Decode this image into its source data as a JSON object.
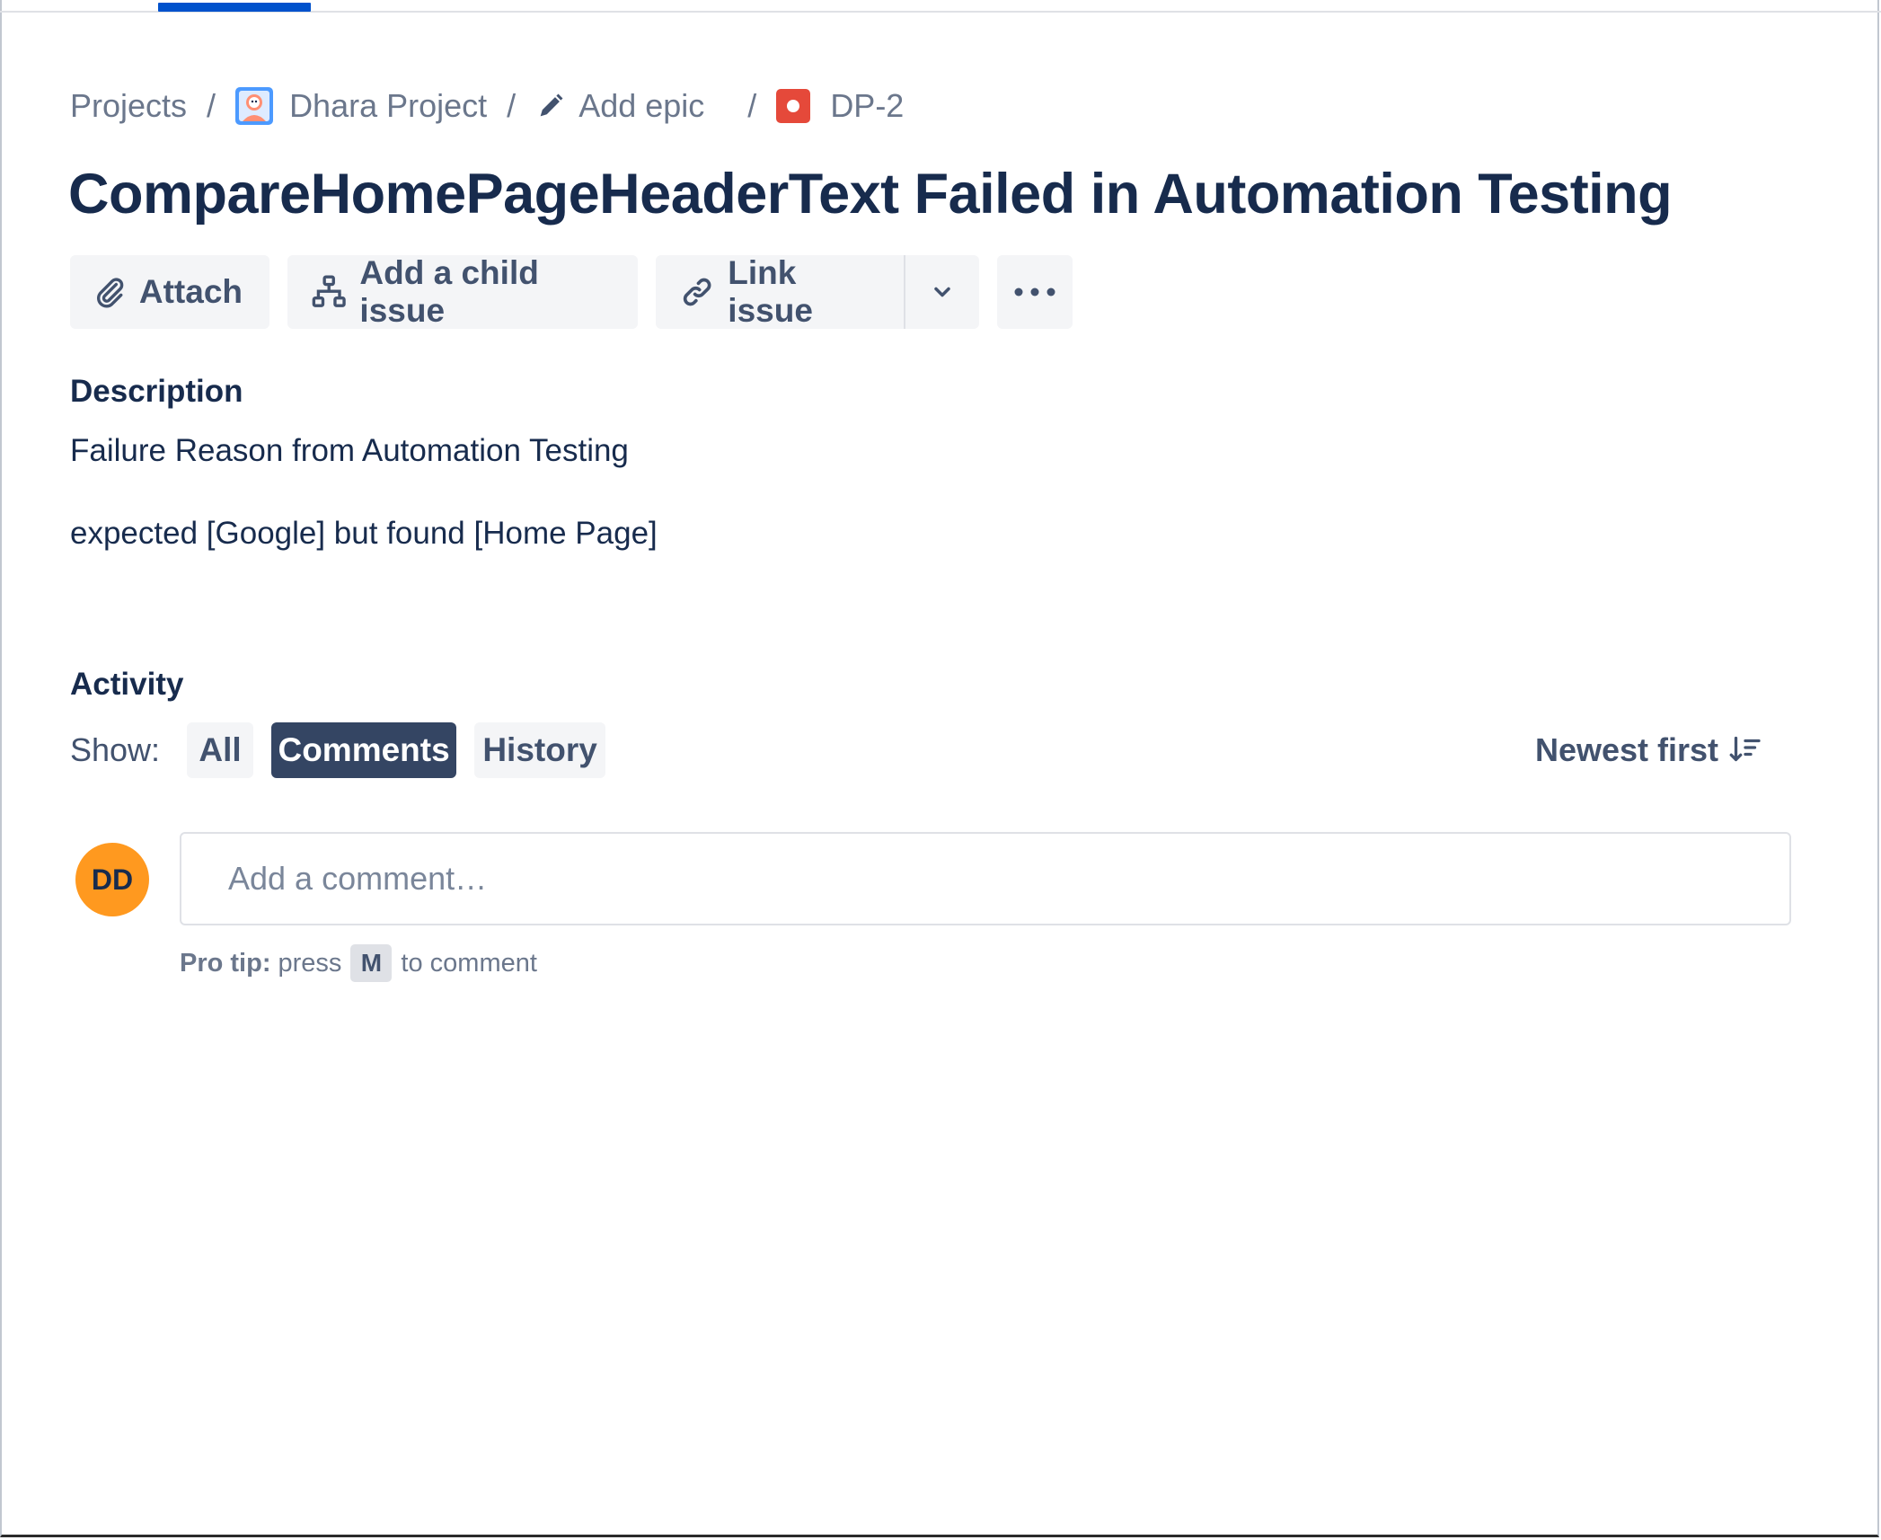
{
  "breadcrumb": {
    "projects": "Projects",
    "separator": "/",
    "project_name": "Dhara Project",
    "epic": "Add epic",
    "issue_key": "DP-2",
    "icons": {
      "project": "project-avatar-icon",
      "epic": "pencil-icon",
      "issue": "bug-icon"
    }
  },
  "issue": {
    "title": "CompareHomePageHeaderText Failed in Automation Testing"
  },
  "toolbar": {
    "attach_label": "Attach",
    "child_label": "Add a child issue",
    "link_label": "Link issue"
  },
  "description": {
    "label": "Description",
    "line1": "Failure Reason from Automation Testing",
    "line2": "expected [Google] but found [Home Page]"
  },
  "activity": {
    "label": "Activity",
    "show_label": "Show:",
    "filters": [
      {
        "label": "All",
        "active": false
      },
      {
        "label": "Comments",
        "active": true
      },
      {
        "label": "History",
        "active": false
      }
    ],
    "sort_label": "Newest first"
  },
  "comment": {
    "avatar_initials": "DD",
    "placeholder": "Add a comment…",
    "tip_bold": "Pro tip:",
    "tip_pre": "press",
    "tip_key": "M",
    "tip_post": "to comment"
  },
  "colors": {
    "accent": "#0052cc",
    "active_filter": "#344563",
    "avatar": "#ff991f",
    "bug": "#e5493a",
    "text": "#172b4d",
    "muted": "#6b778c"
  }
}
